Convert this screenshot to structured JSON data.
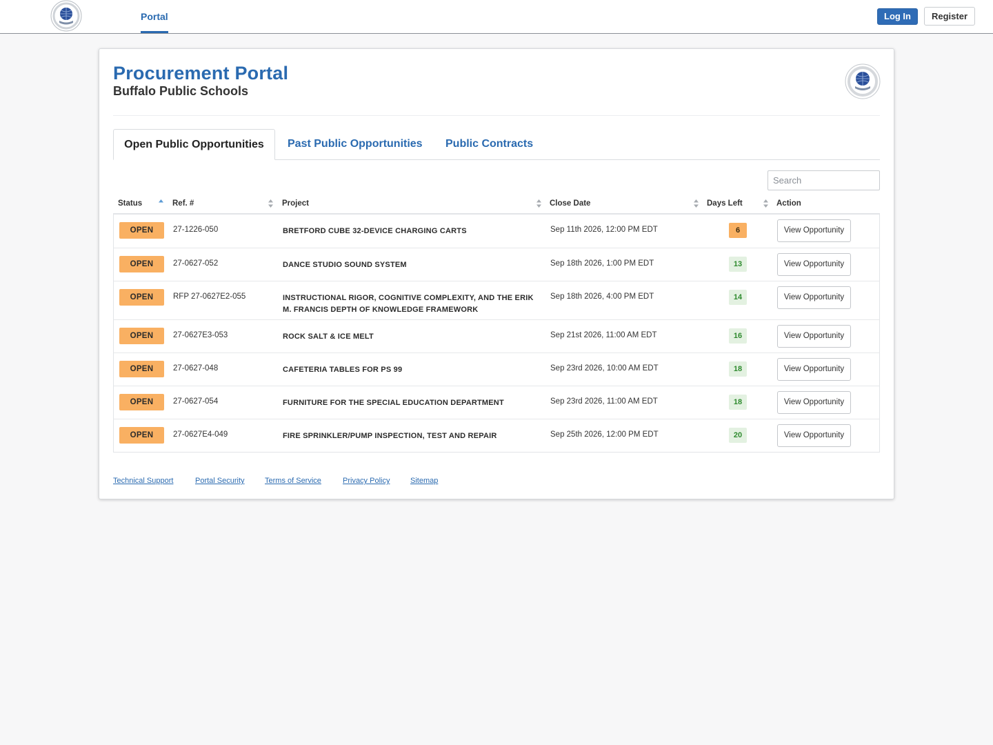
{
  "navbar": {
    "logo_icon": "district-seal-icon",
    "portal_tab": "Portal",
    "login_label": "Log In",
    "register_label": "Register"
  },
  "header": {
    "title": "Procurement Portal",
    "subtitle": "Buffalo Public Schools",
    "logo_icon": "district-seal-icon"
  },
  "tabs": [
    {
      "label": "Open Public Opportunities",
      "active": true
    },
    {
      "label": "Past Public Opportunities",
      "active": false
    },
    {
      "label": "Public Contracts",
      "active": false
    }
  ],
  "search": {
    "placeholder": "Search",
    "value": ""
  },
  "table": {
    "columns": [
      "Status",
      "Ref. #",
      "Project",
      "Close Date",
      "Days Left",
      "Action"
    ],
    "sorted_column": "Status",
    "rows": [
      {
        "status": "OPEN",
        "ref": "27-1226-050",
        "project": "BRETFORD CUBE 32-DEVICE CHARGING CARTS",
        "close_date": "Sep 11th 2026, 12:00 PM EDT",
        "days_left": "6",
        "action": "View Opportunity"
      },
      {
        "status": "OPEN",
        "ref": "27-0627-052",
        "project": "DANCE STUDIO SOUND SYSTEM",
        "close_date": "Sep 18th 2026, 1:00 PM EDT",
        "days_left": "13",
        "action": "View Opportunity"
      },
      {
        "status": "OPEN",
        "ref": "RFP 27-0627E2-055",
        "project": "INSTRUCTIONAL RIGOR, COGNITIVE COMPLEXITY, AND THE ERIK M. FRANCIS DEPTH OF KNOWLEDGE FRAMEWORK",
        "close_date": "Sep 18th 2026, 4:00 PM EDT",
        "days_left": "14",
        "action": "View Opportunity"
      },
      {
        "status": "OPEN",
        "ref": "27-0627E3-053",
        "project": "ROCK SALT & ICE MELT",
        "close_date": "Sep 21st 2026, 11:00 AM EDT",
        "days_left": "16",
        "action": "View Opportunity"
      },
      {
        "status": "OPEN",
        "ref": "27-0627-048",
        "project": "CAFETERIA TABLES FOR PS 99",
        "close_date": "Sep 23rd 2026, 10:00 AM EDT",
        "days_left": "18",
        "action": "View Opportunity"
      },
      {
        "status": "OPEN",
        "ref": "27-0627-054",
        "project": "FURNITURE FOR THE SPECIAL EDUCATION DEPARTMENT",
        "close_date": "Sep 23rd 2026, 11:00 AM EDT",
        "days_left": "18",
        "action": "View Opportunity"
      },
      {
        "status": "OPEN",
        "ref": "27-0627E4-049",
        "project": "FIRE SPRINKLER/PUMP INSPECTION, TEST AND REPAIR",
        "close_date": "Sep 25th 2026, 12:00 PM EDT",
        "days_left": "20",
        "action": "View Opportunity"
      }
    ]
  },
  "footer": {
    "links": [
      "Technical Support",
      "Portal Security",
      "Terms of Service",
      "Privacy Policy",
      "Sitemap"
    ]
  },
  "colors": {
    "brand_blue": "#2a6ab0",
    "open_badge": "#f9b062",
    "days_warning": "#f9b062",
    "days_ok_bg": "#e3f1e1",
    "days_ok_text": "#2e8a2e"
  }
}
